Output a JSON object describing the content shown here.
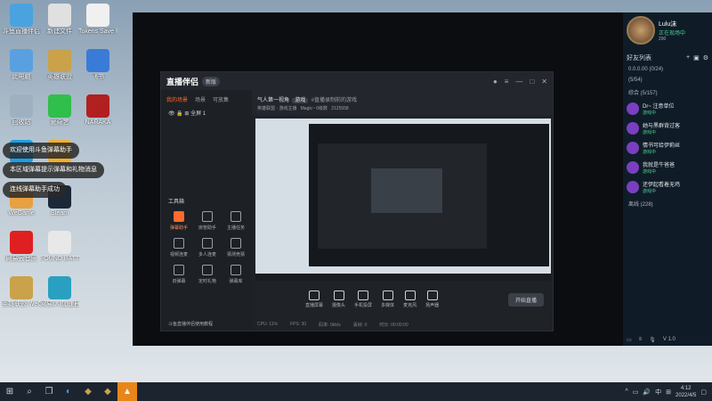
{
  "desktop": {
    "icons": [
      {
        "label": "斗鱼直播伴侣",
        "col": 0,
        "row": 0,
        "color": "#4aa3df"
      },
      {
        "label": "新建文件",
        "col": 1,
        "row": 0,
        "color": "#e0e0e0"
      },
      {
        "label": "Tokens Save Flowed Pa...",
        "col": 2,
        "row": 0,
        "color": "#f0f0f0"
      },
      {
        "label": "此电脑",
        "col": 0,
        "row": 1,
        "color": "#5aa0e0"
      },
      {
        "label": "英雄联盟",
        "col": 1,
        "row": 1,
        "color": "#c9a24a"
      },
      {
        "label": "飞书",
        "col": 2,
        "row": 1,
        "color": "#3b7bd8"
      },
      {
        "label": "回收站",
        "col": 0,
        "row": 2,
        "color": "#9fb0c0"
      },
      {
        "label": "爱奇艺",
        "col": 1,
        "row": 2,
        "color": "#2fbf4a"
      },
      {
        "label": "NARAKA",
        "col": 2,
        "row": 2,
        "color": "#b02020"
      },
      {
        "label": "腾讯QQ",
        "col": 0,
        "row": 3,
        "color": "#1aa0e8"
      },
      {
        "label": "QQ游戏",
        "col": 1,
        "row": 3,
        "color": "#f0b030"
      },
      {
        "label": "WeGame",
        "col": 0,
        "row": 4,
        "color": "#e8a040"
      },
      {
        "label": "Steam",
        "col": 1,
        "row": 4,
        "color": "#1b2838"
      },
      {
        "label": "网易云音乐",
        "col": 0,
        "row": 5,
        "color": "#e02020"
      },
      {
        "label": "FOUND BATTLEGROUNDS",
        "col": 1,
        "row": 5,
        "color": "#e8e8e8"
      },
      {
        "label": "英雄联盟 WeGame版",
        "col": 0,
        "row": 6,
        "color": "#c9a24a"
      },
      {
        "label": "网易UU加速器",
        "col": 1,
        "row": 6,
        "color": "#2aa0c0"
      }
    ],
    "toasts": [
      "欢迎使用斗鱼弹幕助手",
      "本区域弹幕提示弹幕和礼物消息",
      "连线弹幕助手成功"
    ]
  },
  "app": {
    "logo": "直播伴侣",
    "version": "新版",
    "left_tabs": [
      "我的场景",
      "场景",
      "可放集"
    ],
    "scene_label": "全屏 1",
    "tools_title": "工具箱",
    "tools": [
      "弹幕助手",
      "房管助手",
      "主播任务",
      "视频连麦",
      "多人连麦",
      "猜测竞猜",
      "旧弹幕",
      "定时礼物",
      "弹幕库"
    ],
    "footer": "斗鱼直播伴侣使用教程",
    "room_title": "气人第一视角",
    "room_tag": "游戏",
    "room_desc": "#直播录制前的游戏",
    "room_line2": "英雄联盟 · 游戏主播",
    "magic": "Magic~ 0级数",
    "room_id": "2125558",
    "bottom_tools": [
      "直播屏幕",
      "摄像头",
      "手机投屏",
      "多媒体",
      "麦克风",
      "扬声器"
    ],
    "start_label": "开始直播",
    "status_items": [
      "CPU: 11%",
      "FPS: 30",
      "码率: 0kb/s",
      "丢帧: 0",
      "时长: 00:00:00"
    ]
  },
  "friends": {
    "name": "Lulu沫",
    "status": "正在现场中",
    "level": "290",
    "header": "好友列表",
    "groups": [
      {
        "label": "0.0.0.00 (0/24)"
      },
      {
        "label": "(5/54)"
      },
      {
        "label": "综合 (5/157)"
      }
    ],
    "list": [
      {
        "name": "Dr~ 注意单位",
        "status": "游戏中"
      },
      {
        "name": "她与黑群背过客",
        "status": "游戏中"
      },
      {
        "name": "情书可给伊莉丝",
        "status": "游戏中"
      },
      {
        "name": "我就是牛爸爸",
        "status": "游戏中"
      },
      {
        "name": "还伊起看着无鸡",
        "status": "游戏中"
      }
    ],
    "offline": "离线 (228)",
    "footer_ver": "V 1.0"
  },
  "taskbar": {
    "time": "4:12",
    "date": "2022/4/5",
    "tray_lang": "中"
  }
}
